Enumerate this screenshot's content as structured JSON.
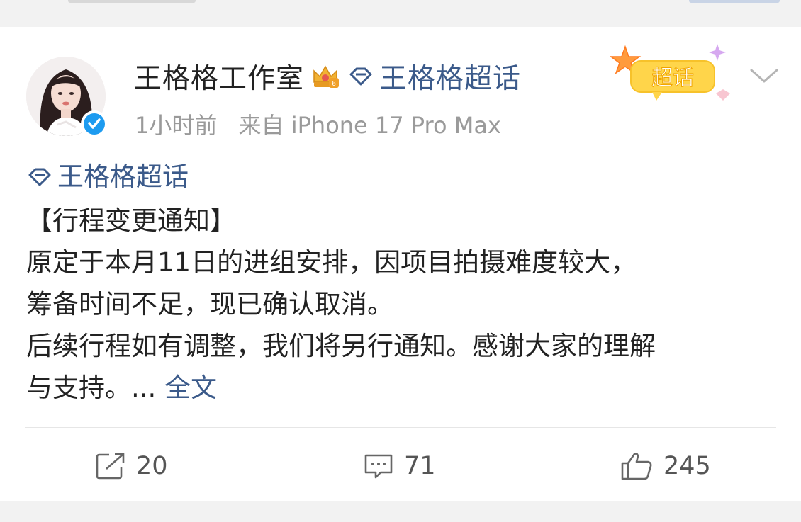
{
  "post": {
    "author": "王格格工作室",
    "supertopic": "王格格超话",
    "time": "1小时前",
    "source": "来自 iPhone 17 Pro Max",
    "badge_sticker_text": "超话",
    "body_topic": "王格格超话",
    "body_lines": [
      "【行程变更通知】",
      "原定于本月11日的进组安排，因项目拍摄难度较大，",
      "筹备时间不足，现已确认取消。",
      "后续行程如有调整，我们将另行通知。感谢大家的理解"
    ],
    "last_line_text": "与支持。...",
    "full_text_link": "全文"
  },
  "actions": {
    "repost_count": "20",
    "comment_count": "71",
    "like_count": "245"
  },
  "colors": {
    "link_blue": "#3b5a8a",
    "verify_blue": "#1d9bf0",
    "card_bg": "#ffffff",
    "page_bg": "#f2f2f2"
  },
  "icons": {
    "crown": "crown-badge-icon",
    "diamond": "supertopic-diamond-icon",
    "verify": "verified-check-icon",
    "more": "chevron-down-icon",
    "repost": "repost-icon",
    "comment": "comment-icon",
    "like": "thumbs-up-icon"
  }
}
